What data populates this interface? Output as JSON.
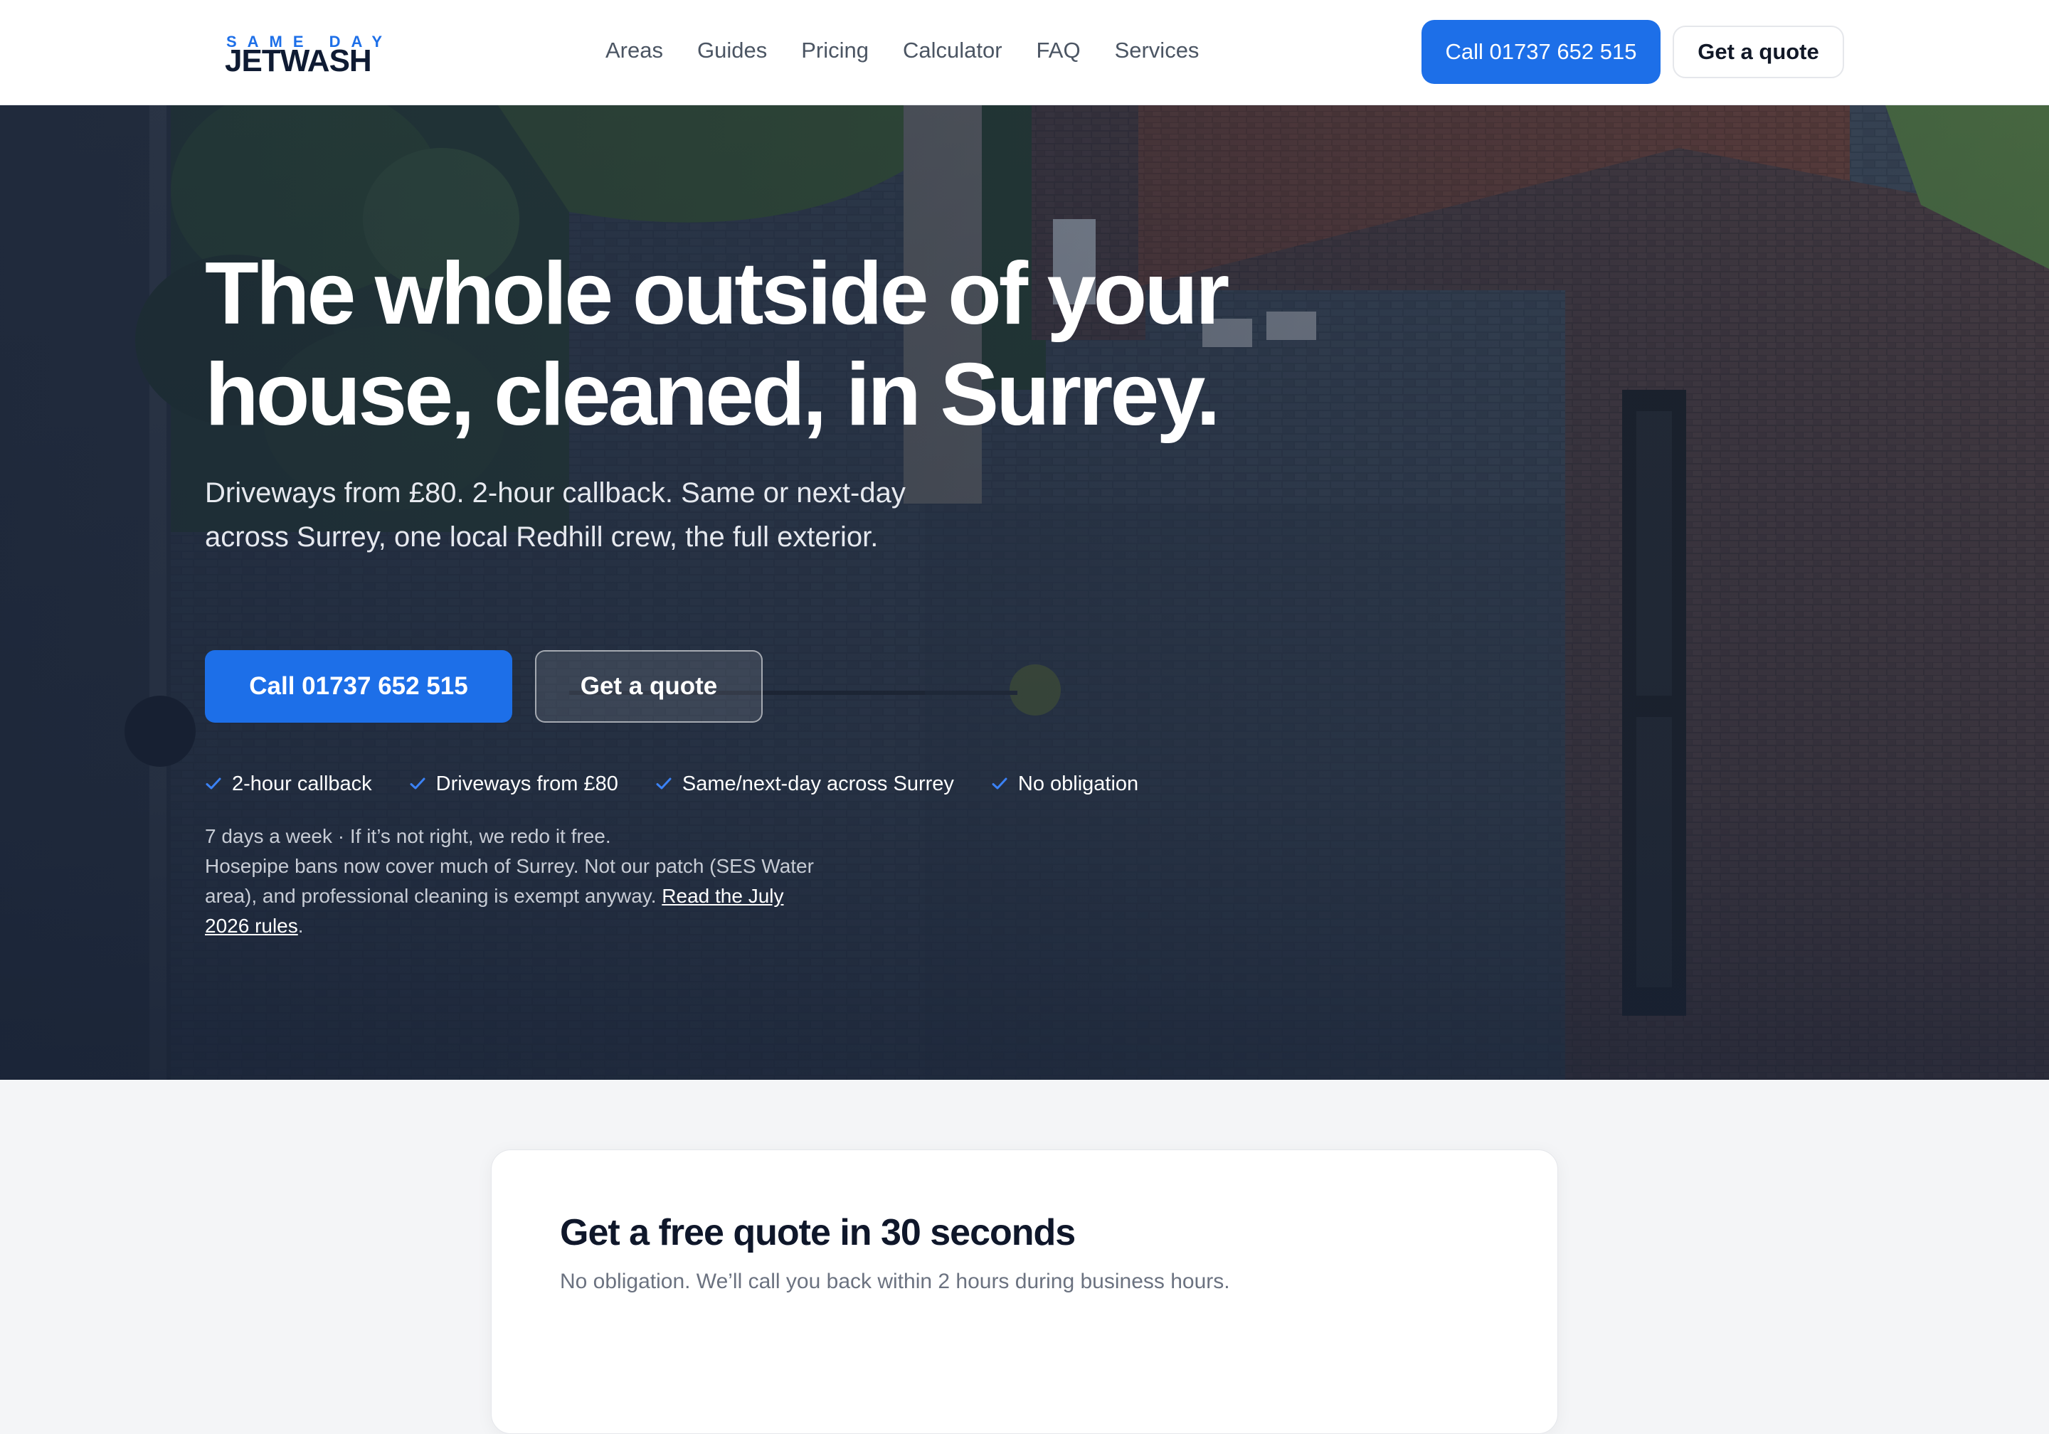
{
  "header": {
    "logo": {
      "top": "SAME DAY",
      "main": "JETWASH"
    },
    "nav": [
      "Areas",
      "Guides",
      "Pricing",
      "Calculator",
      "FAQ",
      "Services"
    ],
    "call_label": "Call 01737 652 515",
    "quote_label": "Get a quote"
  },
  "hero": {
    "title_line1": "The whole outside of your",
    "title_line2": "house, cleaned, in Surrey.",
    "subtitle": "Driveways from £80. 2-hour callback. Same or next-day across Surrey, one local Redhill crew, the full exterior.",
    "call_label": "Call 01737 652 515",
    "quote_label": "Get a quote",
    "features": [
      "2-hour callback",
      "Driveways from £80",
      "Same/next-day across Surrey",
      "No obligation"
    ],
    "note_line1": "7 days a week · If it’s not right, we redo it free.",
    "note_line2": "Hosepipe bans now cover much of Surrey. Not our patch (SES Water area), and professional cleaning is exempt anyway.",
    "note_link": "Read the July 2026 rules",
    "note_end": "."
  },
  "quote_form": {
    "title": "Get a free quote in 30 seconds",
    "subtitle": "No obligation. We’ll call you back within 2 hours during business hours."
  },
  "colors": {
    "primary": "#1d6fe8",
    "dark_text": "#0f172a",
    "nav_text": "#4b5563",
    "hero_overlay": "#162034"
  },
  "icons": {
    "feature_check": "check-icon",
    "logo": "jetwash-logo"
  }
}
